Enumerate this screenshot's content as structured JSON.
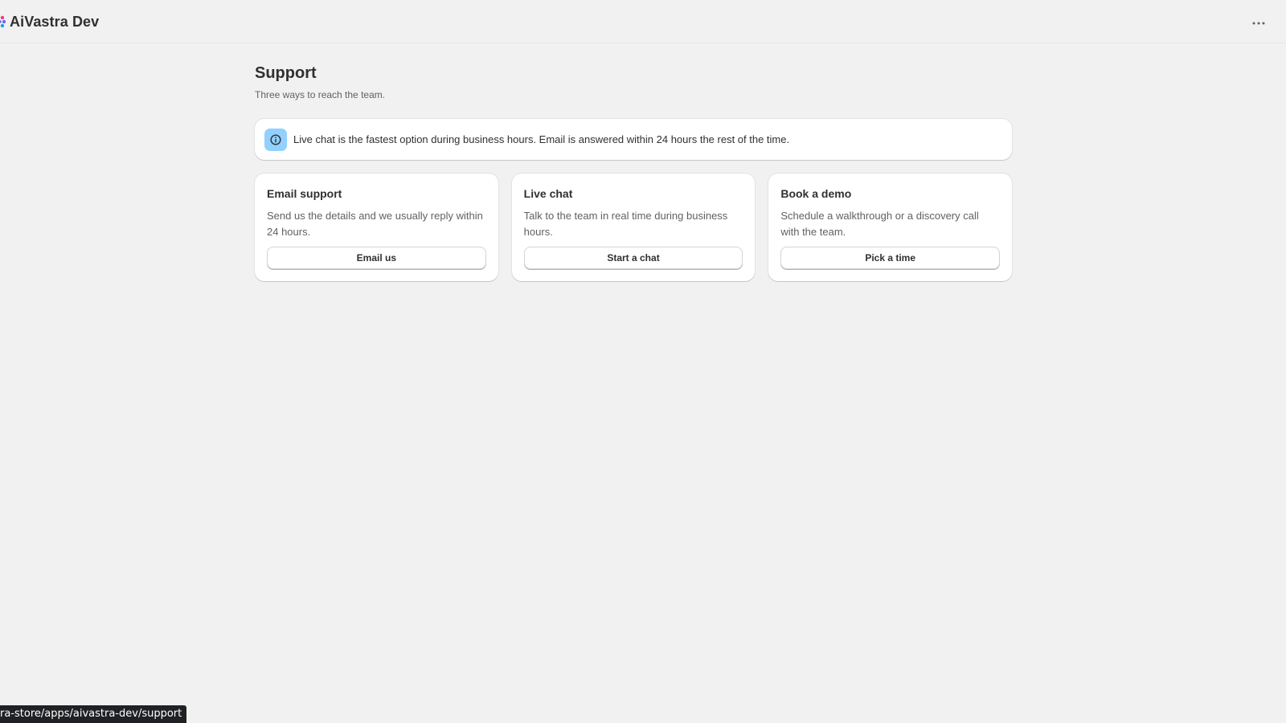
{
  "header": {
    "app_title": "AiVastra Dev",
    "logo_icon": "aivastra-logo-icon",
    "more_icon": "more-horizontal-icon"
  },
  "page": {
    "title": "Support",
    "subtitle": "Three ways to reach the team."
  },
  "banner": {
    "icon": "info-icon",
    "text": "Live chat is the fastest option during business hours. Email is answered within 24 hours the rest of the time."
  },
  "cards": [
    {
      "title": "Email support",
      "description": "Send us the details and we usually reply within 24 hours.",
      "button": "Email us"
    },
    {
      "title": "Live chat",
      "description": "Talk to the team in real time during business hours.",
      "button": "Start a chat"
    },
    {
      "title": "Book a demo",
      "description": "Schedule a walkthrough or a discovery call with the team.",
      "button": "Pick a time"
    }
  ],
  "status_bar": {
    "url": "ra-store/apps/aivastra-dev/support"
  },
  "colors": {
    "background": "#f1f1f1",
    "banner_icon_bg": "#91d0ff",
    "text_primary": "#303030",
    "text_secondary": "#616161"
  }
}
